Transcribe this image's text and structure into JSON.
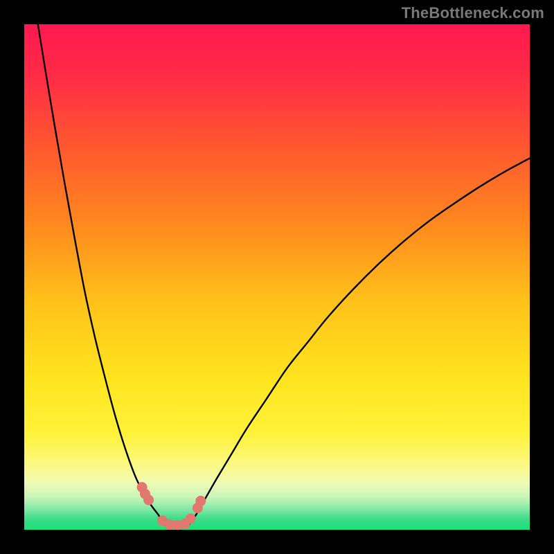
{
  "watermark": "TheBottleneck.com",
  "chart_data": {
    "type": "line",
    "title": "",
    "xlabel": "",
    "ylabel": "",
    "xlim": [
      0,
      100
    ],
    "ylim": [
      0,
      100
    ],
    "series": [
      {
        "name": "left-curve",
        "x": [
          2.7,
          4,
          6,
          8,
          10,
          12,
          14,
          16,
          18,
          20,
          22,
          23.5,
          25,
          26.5,
          27,
          28
        ],
        "y": [
          100,
          92,
          80,
          68.5,
          57.5,
          47,
          38,
          30,
          22.5,
          16,
          10.5,
          7.5,
          5,
          3,
          2.1,
          0.8
        ]
      },
      {
        "name": "right-curve",
        "x": [
          32.5,
          34,
          36,
          38,
          41,
          44,
          48,
          52,
          56,
          60,
          65,
          70,
          75,
          80,
          85,
          90,
          95,
          100
        ],
        "y": [
          0.8,
          3,
          6.5,
          10,
          15,
          20,
          26,
          32,
          37,
          42,
          47.5,
          52.5,
          57,
          61,
          64.5,
          67.8,
          70.8,
          73.5
        ]
      },
      {
        "name": "floor",
        "x": [
          28,
          29.5,
          31,
          32.5
        ],
        "y": [
          0.8,
          0.5,
          0.5,
          0.8
        ]
      }
    ],
    "markers": {
      "name": "marker-dots",
      "x": [
        23.3,
        23.9,
        24.6,
        27.3,
        28.8,
        30.3,
        31.8,
        32.9,
        34.3,
        34.9
      ],
      "y": [
        8.4,
        7.1,
        5.9,
        1.8,
        1.0,
        0.9,
        1.2,
        2.2,
        4.3,
        5.7
      ]
    },
    "gradient_stops": [
      {
        "offset": 0.0,
        "color": "#ff1850"
      },
      {
        "offset": 0.1,
        "color": "#ff2b46"
      },
      {
        "offset": 0.25,
        "color": "#ff5a2e"
      },
      {
        "offset": 0.4,
        "color": "#ff8a1e"
      },
      {
        "offset": 0.55,
        "color": "#ffc21a"
      },
      {
        "offset": 0.7,
        "color": "#ffe41e"
      },
      {
        "offset": 0.81,
        "color": "#fff23a"
      },
      {
        "offset": 0.865,
        "color": "#fdf87a"
      },
      {
        "offset": 0.905,
        "color": "#f1fbb2"
      },
      {
        "offset": 0.935,
        "color": "#c9f6ba"
      },
      {
        "offset": 0.958,
        "color": "#86e9a6"
      },
      {
        "offset": 0.978,
        "color": "#3fdc8a"
      },
      {
        "offset": 1.0,
        "color": "#18e07a"
      }
    ]
  }
}
